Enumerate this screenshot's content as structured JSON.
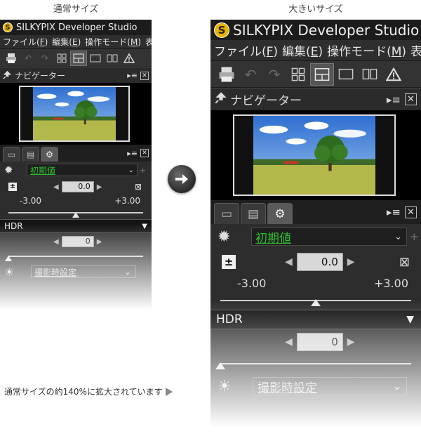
{
  "captions": {
    "normal_size": "通常サイズ",
    "large_size": "大きいサイズ",
    "note": "通常サイズの約140%に拡大されています"
  },
  "app": {
    "title": "SILKYPIX Developer Studio",
    "logo_glyph": "S",
    "accent_color": "#e9b400"
  },
  "menu": [
    {
      "label": "ファイル(",
      "key": "F",
      "end": ")"
    },
    {
      "label": "編集(",
      "key": "E",
      "end": ")"
    },
    {
      "label": "操作モード(",
      "key": "M",
      "end": ")"
    },
    {
      "label": "表",
      "key": "",
      "end": ""
    }
  ],
  "toolbar": {
    "icons": [
      "printer-icon",
      "undo-icon",
      "redo-icon",
      "grid-view-icon",
      "split-view-icon",
      "single-view-icon",
      "compare-view-icon",
      "warning-icon"
    ],
    "active_index": 4
  },
  "navigator": {
    "title": "ナビゲーター",
    "menu_glyph": "▸≡",
    "close_glyph": "✕"
  },
  "panel": {
    "tabs": [
      "folder-tab-icon",
      "comment-tab-icon",
      "develop-settings-tab-icon"
    ],
    "active_tab_index": 2,
    "preset": {
      "value": "初期値",
      "value_color": "#2fbd2f",
      "chevron": "⌄",
      "plus": "+"
    },
    "exposure": {
      "value": "0.0",
      "min_label": "-3.00",
      "max_label": "+3.00",
      "min": -3.0,
      "max": 3.0,
      "current": 0.0
    },
    "hdr": {
      "title": "HDR",
      "value": "0",
      "slider_position": 0.0
    },
    "shooting": {
      "label": "撮影時設定"
    }
  }
}
